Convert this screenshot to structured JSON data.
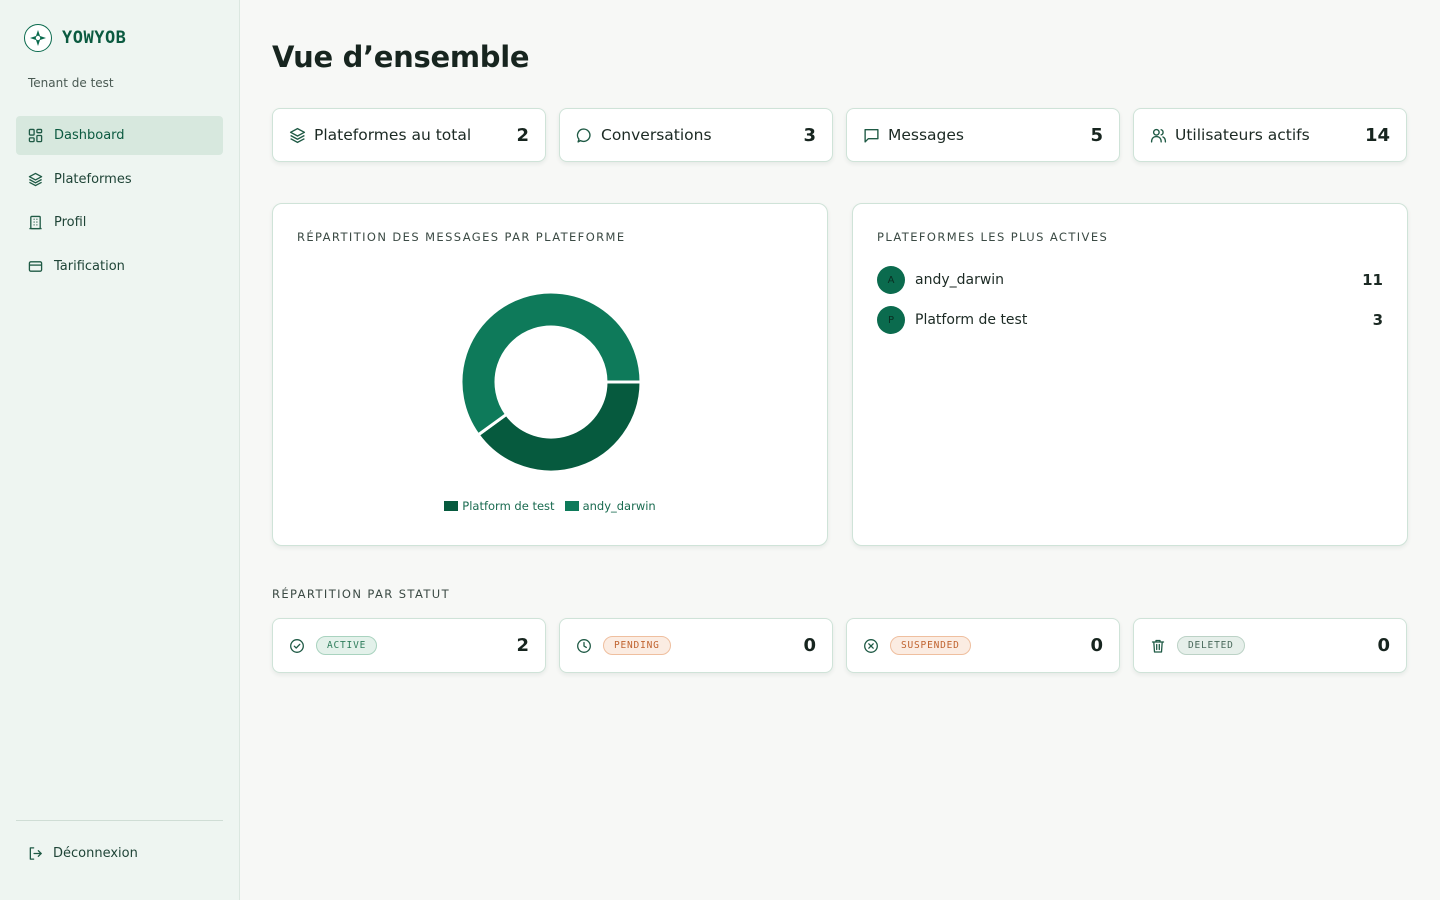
{
  "brand": {
    "name": "YOWYOB",
    "tenant": "Tenant de test"
  },
  "nav": [
    {
      "label": "Dashboard",
      "icon": "dashboard-icon",
      "active": true
    },
    {
      "label": "Plateformes",
      "icon": "layers-icon",
      "active": false
    },
    {
      "label": "Profil",
      "icon": "building-icon",
      "active": false
    },
    {
      "label": "Tarification",
      "icon": "credit-card-icon",
      "active": false
    }
  ],
  "logout_label": "Déconnexion",
  "page_title": "Vue d’ensemble",
  "stats": [
    {
      "label": "Plateformes au total",
      "value": "2",
      "icon": "layers-icon"
    },
    {
      "label": "Conversations",
      "value": "3",
      "icon": "chat-bubble-icon"
    },
    {
      "label": "Messages",
      "value": "5",
      "icon": "message-square-icon"
    },
    {
      "label": "Utilisateurs actifs",
      "value": "14",
      "icon": "users-icon"
    }
  ],
  "messages_panel": {
    "title": "RÉPARTITION DES MESSAGES PAR PLATEFORME"
  },
  "chart_data": {
    "type": "pie",
    "title": "RÉPARTITION DES MESSAGES PAR PLATEFORME",
    "donut": true,
    "labels": [
      "Platform de test",
      "andy_darwin"
    ],
    "values": [
      2,
      3
    ],
    "colors": [
      "#065a3e",
      "#0e7a5a"
    ],
    "legend": "bottom"
  },
  "active_panel": {
    "title": "PLATEFORMES LES PLUS ACTIVES",
    "items": [
      {
        "initial": "A",
        "name": "andy_darwin",
        "count": "11"
      },
      {
        "initial": "P",
        "name": "Platform de test",
        "count": "3"
      }
    ]
  },
  "status_section": {
    "title": "RÉPARTITION PAR STATUT",
    "items": [
      {
        "badge": "ACTIVE",
        "value": "2",
        "icon": "check-circle-icon",
        "color": "#2e7d5b",
        "bg": "#e3f1ea",
        "border": "#a9d3bf"
      },
      {
        "badge": "PENDING",
        "value": "0",
        "icon": "clock-icon",
        "color": "#c0632f",
        "bg": "#fbece2",
        "border": "#efbf9f"
      },
      {
        "badge": "SUSPENDED",
        "value": "0",
        "icon": "x-circle-icon",
        "color": "#c0632f",
        "bg": "#fbece2",
        "border": "#efbf9f"
      },
      {
        "badge": "DELETED",
        "value": "0",
        "icon": "trash-icon",
        "color": "#4a6a5c",
        "bg": "#e6efea",
        "border": "#bcd2c6"
      }
    ]
  }
}
